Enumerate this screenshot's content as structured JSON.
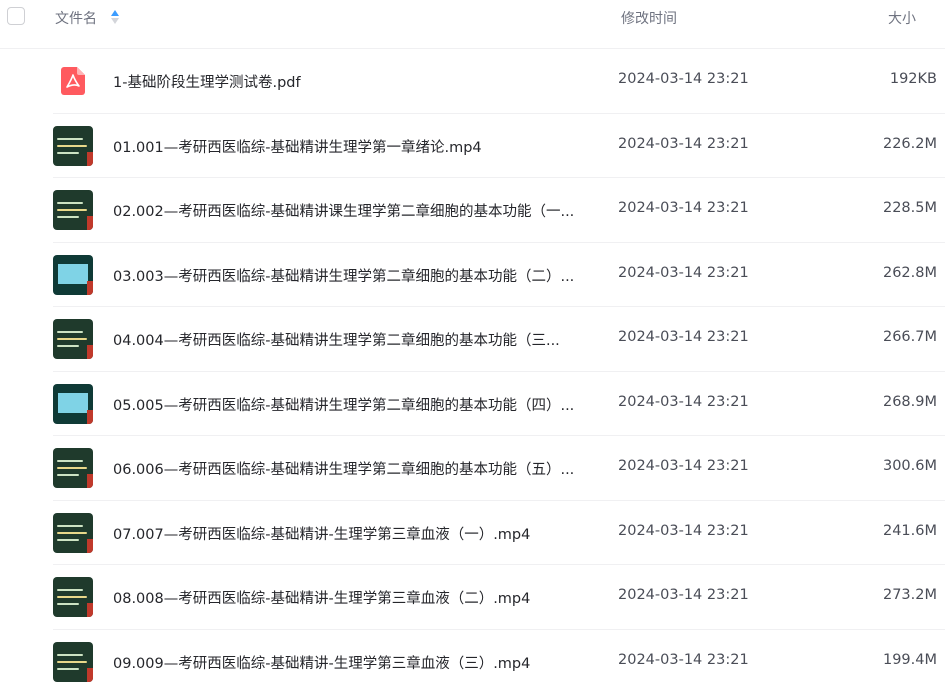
{
  "header": {
    "name_label": "文件名",
    "time_label": "修改时间",
    "size_label": "大小",
    "sort_icon": "sort-ascending-icon",
    "accent_color": "#3b9cff"
  },
  "files": [
    {
      "name": "1-基础阶段生理学测试卷.pdf",
      "time": "2024-03-14 23:21",
      "size": "192KB",
      "type": "pdf",
      "icon": "pdf-icon"
    },
    {
      "name": "01.001—考研西医临综-基础精讲生理学第一章绪论.mp4",
      "time": "2024-03-14 23:21",
      "size": "226.2M",
      "type": "video",
      "icon": "video-thumbnail"
    },
    {
      "name": "02.002—考研西医临综-基础精讲课生理学第二章细胞的基本功能（一...",
      "time": "2024-03-14 23:21",
      "size": "228.5M",
      "type": "video",
      "icon": "video-thumbnail"
    },
    {
      "name": "03.003—考研西医临综-基础精讲生理学第二章细胞的基本功能（二）...",
      "time": "2024-03-14 23:21",
      "size": "262.8M",
      "type": "video",
      "icon": "video-thumbnail"
    },
    {
      "name": "04.004—考研西医临综-基础精讲生理学第二章细胞的基本功能（三...",
      "time": "2024-03-14 23:21",
      "size": "266.7M",
      "type": "video",
      "icon": "video-thumbnail"
    },
    {
      "name": "05.005—考研西医临综-基础精讲生理学第二章细胞的基本功能（四）...",
      "time": "2024-03-14 23:21",
      "size": "268.9M",
      "type": "video",
      "icon": "video-thumbnail"
    },
    {
      "name": "06.006—考研西医临综-基础精讲生理学第二章细胞的基本功能（五）...",
      "time": "2024-03-14 23:21",
      "size": "300.6M",
      "type": "video",
      "icon": "video-thumbnail"
    },
    {
      "name": "07.007—考研西医临综-基础精讲-生理学第三章血液（一）.mp4",
      "time": "2024-03-14 23:21",
      "size": "241.6M",
      "type": "video",
      "icon": "video-thumbnail"
    },
    {
      "name": "08.008—考研西医临综-基础精讲-生理学第三章血液（二）.mp4",
      "time": "2024-03-14 23:21",
      "size": "273.2M",
      "type": "video",
      "icon": "video-thumbnail"
    },
    {
      "name": "09.009—考研西医临综-基础精讲-生理学第三章血液（三）.mp4",
      "time": "2024-03-14 23:21",
      "size": "199.4M",
      "type": "video",
      "icon": "video-thumbnail"
    }
  ]
}
